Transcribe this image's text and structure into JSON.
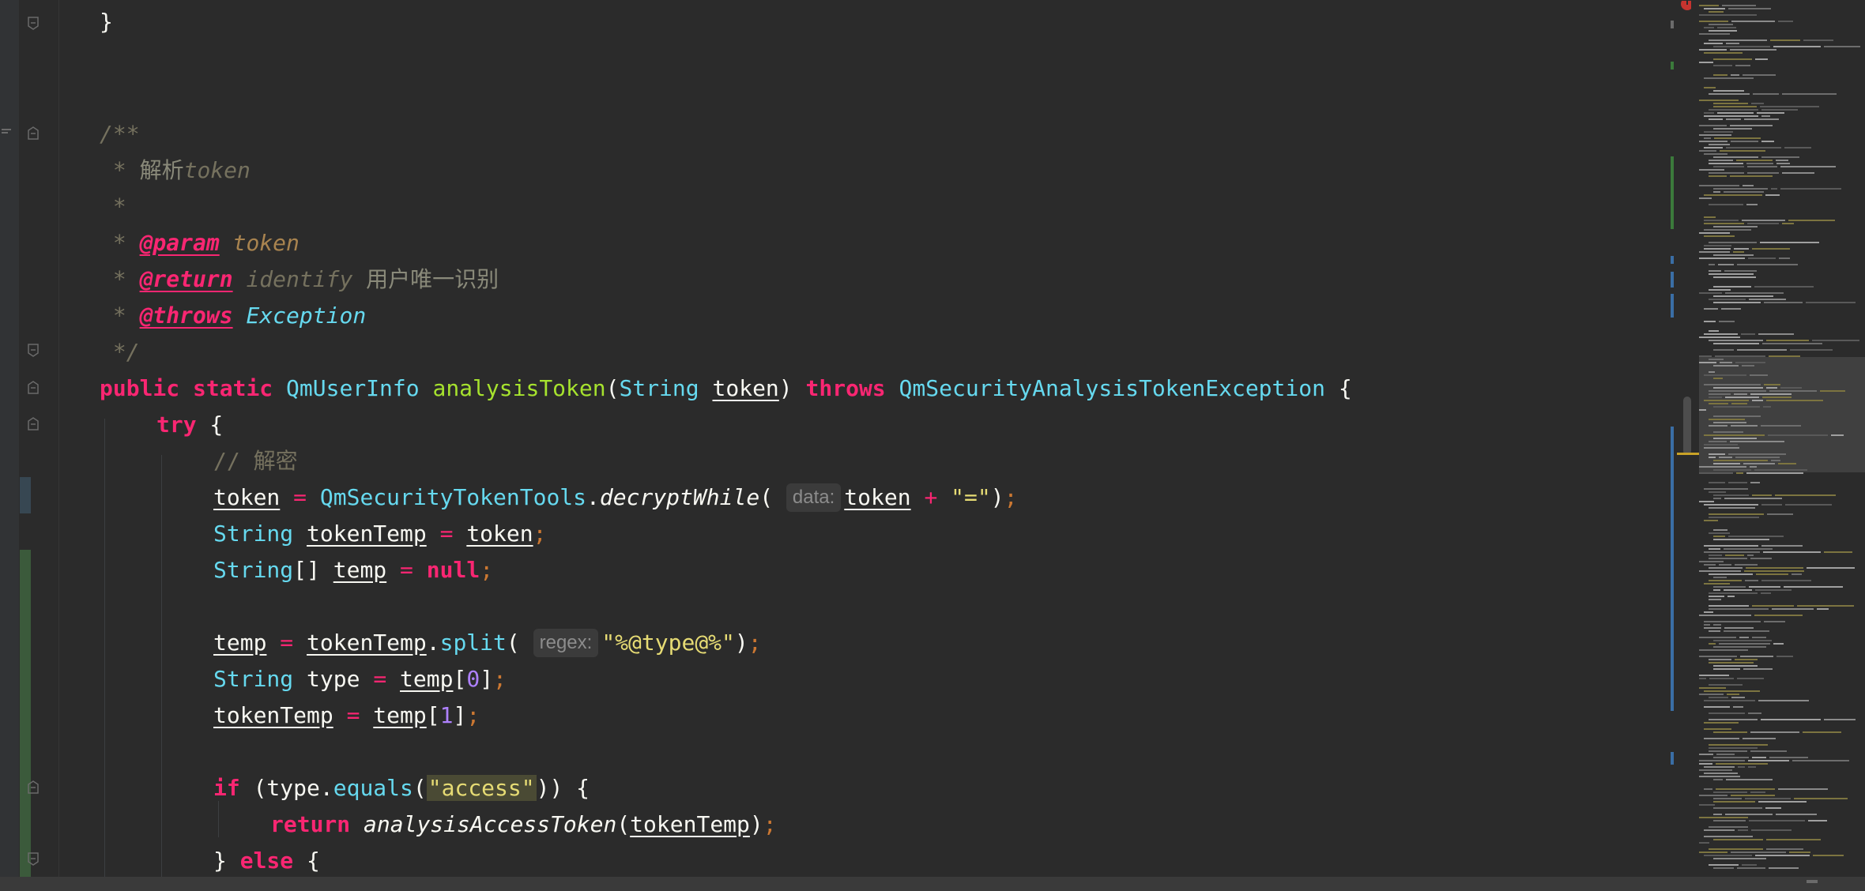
{
  "editor": {
    "lines": [
      {
        "id": "l1",
        "segments": [
          {
            "t": "}",
            "c": "pl"
          }
        ]
      },
      {
        "id": "l2",
        "segments": [
          {
            "t": "/**",
            "c": "cm"
          }
        ]
      },
      {
        "id": "l3",
        "segments": [
          {
            "t": " * ",
            "c": "cm"
          },
          {
            "t": "解析",
            "c": "cm cj"
          },
          {
            "t": "token",
            "c": "cm"
          }
        ]
      },
      {
        "id": "l4",
        "segments": [
          {
            "t": " *",
            "c": "cm"
          }
        ]
      },
      {
        "id": "l5",
        "segments": [
          {
            "t": " * ",
            "c": "cm"
          },
          {
            "t": "@param",
            "c": "tag"
          },
          {
            "t": " ",
            "c": "cm"
          },
          {
            "t": "token",
            "c": "tagv"
          }
        ]
      },
      {
        "id": "l6",
        "segments": [
          {
            "t": " * ",
            "c": "cm"
          },
          {
            "t": "@return",
            "c": "tag"
          },
          {
            "t": " identify ",
            "c": "cm"
          },
          {
            "t": "用户唯一识别",
            "c": "cm cj"
          }
        ]
      },
      {
        "id": "l7",
        "segments": [
          {
            "t": " * ",
            "c": "cm"
          },
          {
            "t": "@throws",
            "c": "tag"
          },
          {
            "t": " ",
            "c": "cm"
          },
          {
            "t": "Exception",
            "c": "exc"
          }
        ]
      },
      {
        "id": "l8",
        "segments": [
          {
            "t": " */",
            "c": "cm"
          }
        ]
      },
      {
        "id": "l9",
        "segments": [
          {
            "t": "public",
            "c": "kw"
          },
          {
            "t": " ",
            "c": "pl"
          },
          {
            "t": "static",
            "c": "kw"
          },
          {
            "t": " ",
            "c": "pl"
          },
          {
            "t": "QmUserInfo",
            "c": "ty"
          },
          {
            "t": " ",
            "c": "pl"
          },
          {
            "t": "analysisToken",
            "c": "fn"
          },
          {
            "t": "(",
            "c": "pl"
          },
          {
            "t": "String",
            "c": "ty"
          },
          {
            "t": " ",
            "c": "pl"
          },
          {
            "t": "token",
            "c": "var"
          },
          {
            "t": ") ",
            "c": "pl"
          },
          {
            "t": "throws",
            "c": "kw"
          },
          {
            "t": " ",
            "c": "pl"
          },
          {
            "t": "QmSecurityAnalysisTokenException",
            "c": "ty"
          },
          {
            "t": " {",
            "c": "pl"
          }
        ]
      },
      {
        "id": "l10",
        "segments": [
          {
            "t": "try",
            "c": "kw"
          },
          {
            "t": " {",
            "c": "pl"
          }
        ]
      },
      {
        "id": "l11",
        "segments": [
          {
            "t": "// ",
            "c": "cmi"
          },
          {
            "t": "解密",
            "c": "cmi"
          }
        ]
      },
      {
        "id": "l12",
        "segments": [
          {
            "t": "token",
            "c": "var"
          },
          {
            "t": " ",
            "c": "pl"
          },
          {
            "t": "=",
            "c": "op"
          },
          {
            "t": " ",
            "c": "pl"
          },
          {
            "t": "QmSecurityTokenTools",
            "c": "ty"
          },
          {
            "t": ".",
            "c": "pl"
          },
          {
            "t": "decryptWhile",
            "c": "pl it"
          },
          {
            "t": "( ",
            "c": "pl"
          },
          {
            "t": "data:",
            "c": "hint"
          },
          {
            "t": "token",
            "c": "var"
          },
          {
            "t": " ",
            "c": "pl"
          },
          {
            "t": "+",
            "c": "op"
          },
          {
            "t": " ",
            "c": "pl"
          },
          {
            "t": "\"=\"",
            "c": "st"
          },
          {
            "t": ")",
            "c": "pl"
          },
          {
            "t": ";",
            "c": "semi"
          }
        ]
      },
      {
        "id": "l13",
        "segments": [
          {
            "t": "String",
            "c": "ty"
          },
          {
            "t": " ",
            "c": "pl"
          },
          {
            "t": "tokenTemp",
            "c": "var"
          },
          {
            "t": " ",
            "c": "pl"
          },
          {
            "t": "=",
            "c": "op"
          },
          {
            "t": " ",
            "c": "pl"
          },
          {
            "t": "token",
            "c": "var"
          },
          {
            "t": ";",
            "c": "semi"
          }
        ]
      },
      {
        "id": "l14",
        "segments": [
          {
            "t": "String",
            "c": "ty"
          },
          {
            "t": "[] ",
            "c": "pl"
          },
          {
            "t": "temp",
            "c": "var"
          },
          {
            "t": " ",
            "c": "pl"
          },
          {
            "t": "=",
            "c": "op"
          },
          {
            "t": " ",
            "c": "pl"
          },
          {
            "t": "null",
            "c": "kw"
          },
          {
            "t": ";",
            "c": "semi"
          }
        ]
      },
      {
        "id": "l15",
        "segments": [
          {
            "t": "temp",
            "c": "var"
          },
          {
            "t": " ",
            "c": "pl"
          },
          {
            "t": "=",
            "c": "op"
          },
          {
            "t": " ",
            "c": "pl"
          },
          {
            "t": "tokenTemp",
            "c": "var"
          },
          {
            "t": ".",
            "c": "pl"
          },
          {
            "t": "split",
            "c": "mc"
          },
          {
            "t": "( ",
            "c": "pl"
          },
          {
            "t": "regex:",
            "c": "hint"
          },
          {
            "t": "\"%@type@%\"",
            "c": "st"
          },
          {
            "t": ")",
            "c": "pl"
          },
          {
            "t": ";",
            "c": "semi"
          }
        ]
      },
      {
        "id": "l16",
        "segments": [
          {
            "t": "String",
            "c": "ty"
          },
          {
            "t": " type ",
            "c": "pl"
          },
          {
            "t": "=",
            "c": "op"
          },
          {
            "t": " ",
            "c": "pl"
          },
          {
            "t": "temp",
            "c": "var"
          },
          {
            "t": "[",
            "c": "pl"
          },
          {
            "t": "0",
            "c": "nm"
          },
          {
            "t": "]",
            "c": "pl"
          },
          {
            "t": ";",
            "c": "semi"
          }
        ]
      },
      {
        "id": "l17",
        "segments": [
          {
            "t": "tokenTemp",
            "c": "var"
          },
          {
            "t": " ",
            "c": "pl"
          },
          {
            "t": "=",
            "c": "op"
          },
          {
            "t": " ",
            "c": "pl"
          },
          {
            "t": "temp",
            "c": "var"
          },
          {
            "t": "[",
            "c": "pl"
          },
          {
            "t": "1",
            "c": "nm"
          },
          {
            "t": "]",
            "c": "pl"
          },
          {
            "t": ";",
            "c": "semi"
          }
        ]
      },
      {
        "id": "l18",
        "segments": [
          {
            "t": "if",
            "c": "kw"
          },
          {
            "t": " (type.",
            "c": "pl"
          },
          {
            "t": "equals",
            "c": "mc"
          },
          {
            "t": "(",
            "c": "pl"
          },
          {
            "t": "\"access\"",
            "c": "st st-hl"
          },
          {
            "t": ")) {",
            "c": "pl"
          }
        ]
      },
      {
        "id": "l19",
        "segments": [
          {
            "t": "return",
            "c": "kw"
          },
          {
            "t": " ",
            "c": "pl"
          },
          {
            "t": "analysisAccessToken",
            "c": "pl it"
          },
          {
            "t": "(",
            "c": "pl"
          },
          {
            "t": "tokenTemp",
            "c": "var"
          },
          {
            "t": ")",
            "c": "pl"
          },
          {
            "t": ";",
            "c": "semi"
          }
        ]
      },
      {
        "id": "l20",
        "segments": [
          {
            "t": "} ",
            "c": "pl"
          },
          {
            "t": "else",
            "c": "kw"
          },
          {
            "t": " {",
            "c": "pl"
          }
        ]
      }
    ]
  },
  "colors": {
    "background": "#2b2b2b",
    "keyword": "#f92672",
    "type": "#66d9ef",
    "method": "#a6e22e",
    "string": "#e6db74",
    "number": "#ae81ff",
    "comment": "#75715e",
    "vcs_added": "#3b5a3b",
    "vcs_modified": "#374752"
  },
  "icons": [
    "fold-marker-icon",
    "bookmark-icon",
    "error-icon"
  ]
}
